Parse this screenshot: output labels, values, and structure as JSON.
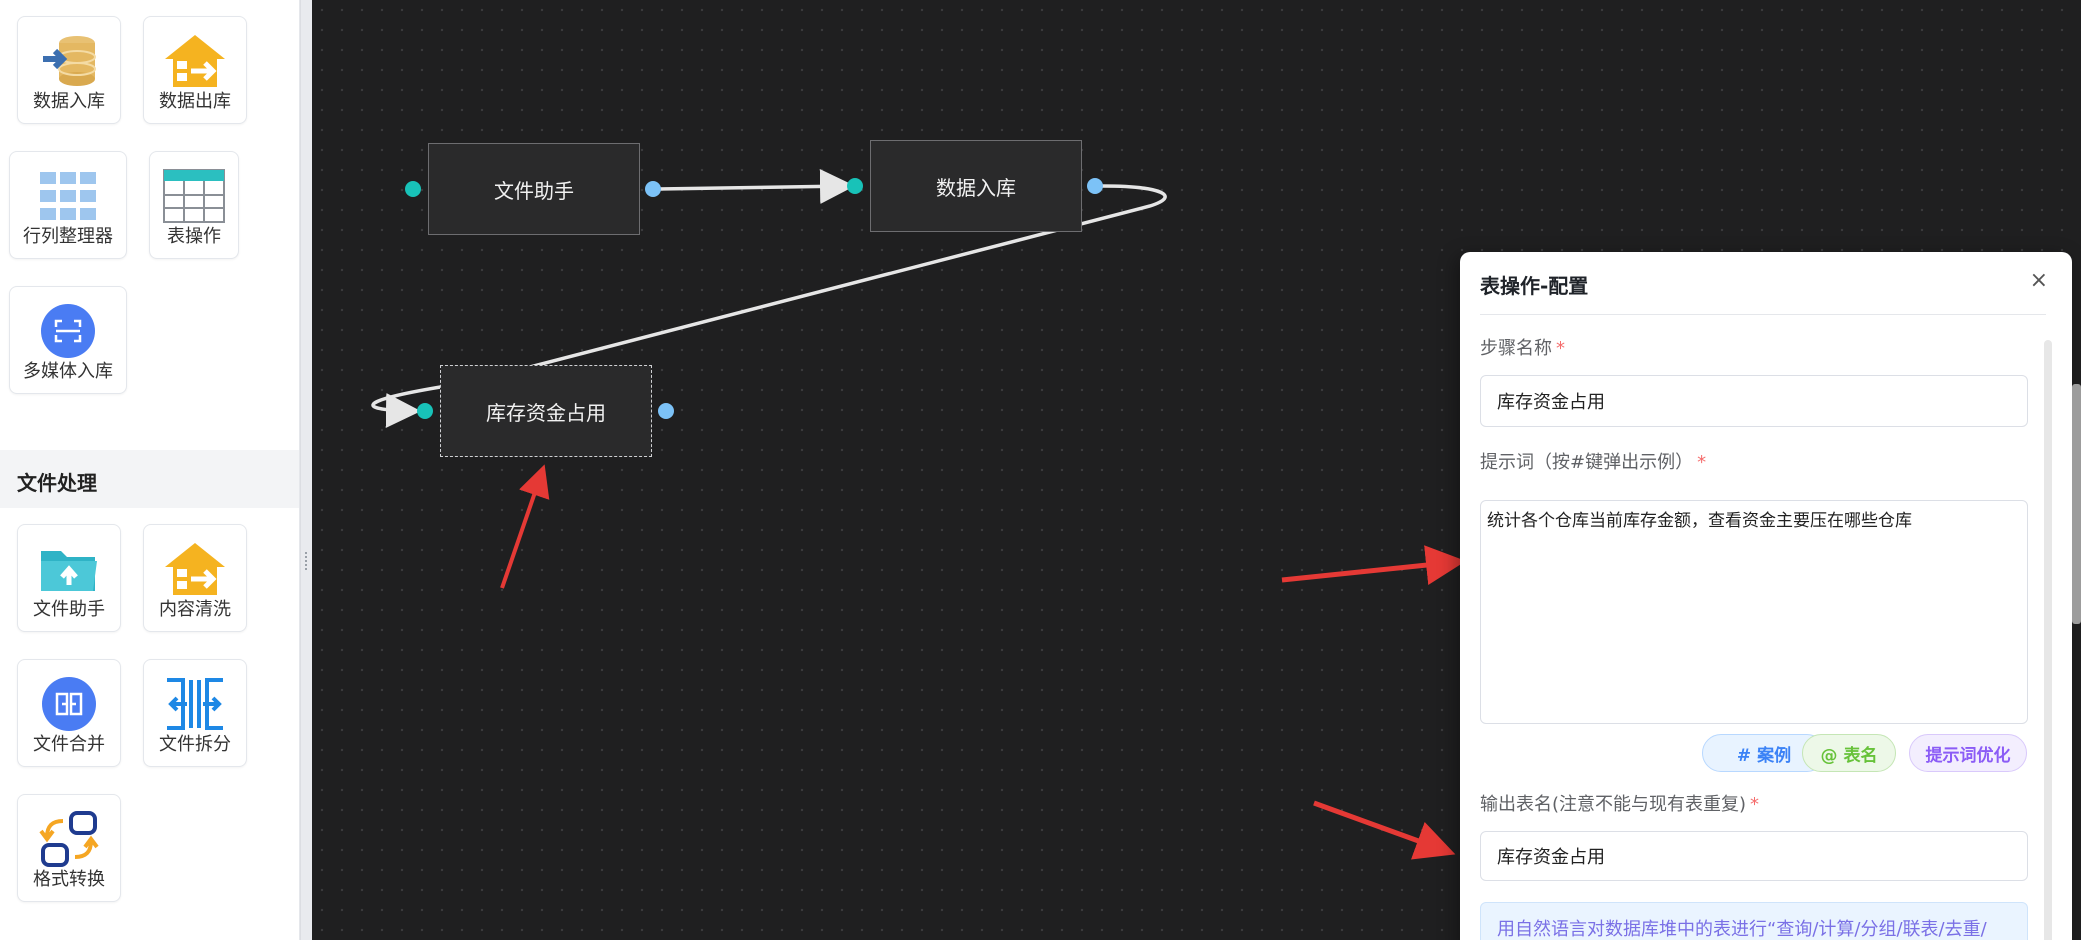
{
  "sidebar": {
    "tiles_top": [
      {
        "label": "数据入库",
        "icon": "database-import-icon"
      },
      {
        "label": "数据出库",
        "icon": "warehouse-export-icon"
      },
      {
        "label": "行列整理器",
        "icon": "grid-organizer-icon"
      },
      {
        "label": "表操作",
        "icon": "table-icon"
      },
      {
        "label": "多媒体入库",
        "icon": "media-scan-icon"
      }
    ],
    "section_title": "文件处理",
    "tiles_file": [
      {
        "label": "文件助手",
        "icon": "folder-upload-icon"
      },
      {
        "label": "内容清洗",
        "icon": "warehouse-clean-icon"
      },
      {
        "label": "文件合并",
        "icon": "merge-icon"
      },
      {
        "label": "文件拆分",
        "icon": "split-icon"
      },
      {
        "label": "格式转换",
        "icon": "convert-icon"
      }
    ]
  },
  "canvas": {
    "nodes": [
      {
        "label": "文件助手"
      },
      {
        "label": "数据入库"
      },
      {
        "label": "库存资金占用"
      }
    ]
  },
  "panel": {
    "title": "表操作-配置",
    "close_glyph": "×",
    "step_name_label": "步骤名称",
    "step_name_value": "库存资金占用",
    "prompt_label": "提示词（按#键弹出示例）",
    "prompt_value": "统计各个仓库当前库存金额，查看资金主要压在哪些仓库",
    "chip_case": "# 案例",
    "chip_table": "@ 表名",
    "chip_optimize": "提示词优化",
    "output_label": "输出表名(注意不能与现有表重复)",
    "output_value": "库存资金占用",
    "tip_text": "用自然语言对数据库堆中的表进行“查询/计算/分组/联表/去重/",
    "required_mark": "*"
  },
  "colors": {
    "canvas_bg": "#1f1f20",
    "port_in": "#18c2b8",
    "port_out": "#7cc2f7",
    "annotation_arrow": "#e53935"
  }
}
